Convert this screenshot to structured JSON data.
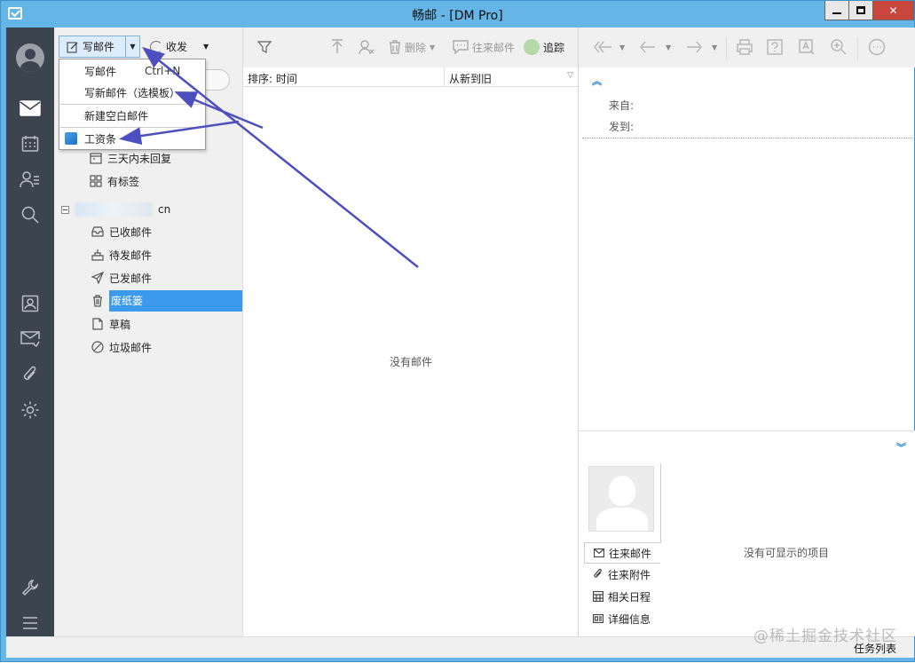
{
  "window": {
    "title": "畅邮 - [DM Pro]",
    "min_label": "",
    "max_label": "",
    "close_label": "✕"
  },
  "nav_rail": {
    "items": [
      "avatar-icon",
      "mail-icon",
      "calendar-icon",
      "contacts-icon",
      "search-icon",
      "address-book-icon",
      "send-mail-icon",
      "attachment-icon",
      "settings-icon",
      "tools-icon",
      "menu-icon"
    ]
  },
  "folder_pane": {
    "compose_label": "写邮件",
    "receive_label": "收发",
    "compose_menu": [
      {
        "label": "写邮件",
        "shortcut": "Ctrl+N"
      },
      {
        "label": "写新邮件（选模板）"
      },
      {
        "label": "新建空白邮件"
      },
      {
        "label": "工资条"
      }
    ],
    "smart_folders": [
      {
        "label": "三天内未回复"
      },
      {
        "label": "有标签"
      }
    ],
    "account_suffix": "cn",
    "folders": [
      {
        "label": "已收邮件",
        "icon": "inbox-icon"
      },
      {
        "label": "待发邮件",
        "icon": "outbox-icon"
      },
      {
        "label": "已发邮件",
        "icon": "sent-icon"
      },
      {
        "label": "废纸篓",
        "icon": "trash-icon",
        "selected": true
      },
      {
        "label": "草稿",
        "icon": "draft-icon"
      },
      {
        "label": "垃圾邮件",
        "icon": "spam-icon"
      }
    ]
  },
  "message_list": {
    "toolbar": {
      "delete_label": "删除",
      "correspondence_label": "往来邮件",
      "track_label": "追踪"
    },
    "sort_label": "排序: 时间",
    "order_label": "从新到旧",
    "empty_text": "没有邮件"
  },
  "reading_pane": {
    "from_label": "来自:",
    "to_label": "发到:",
    "contact_tabs": [
      {
        "label": "往来邮件"
      },
      {
        "label": "往来附件"
      },
      {
        "label": "相关日程"
      },
      {
        "label": "详细信息"
      }
    ],
    "no_items_text": "没有可显示的项目"
  },
  "status_bar": {
    "task_list_label": "任务列表"
  },
  "watermark": "@稀土掘金技术社区",
  "colors": {
    "titlebar": "#65b5e6",
    "rail": "#3c4450",
    "selection": "#3b99ee",
    "annotation_arrow": "#4c4fbd"
  }
}
